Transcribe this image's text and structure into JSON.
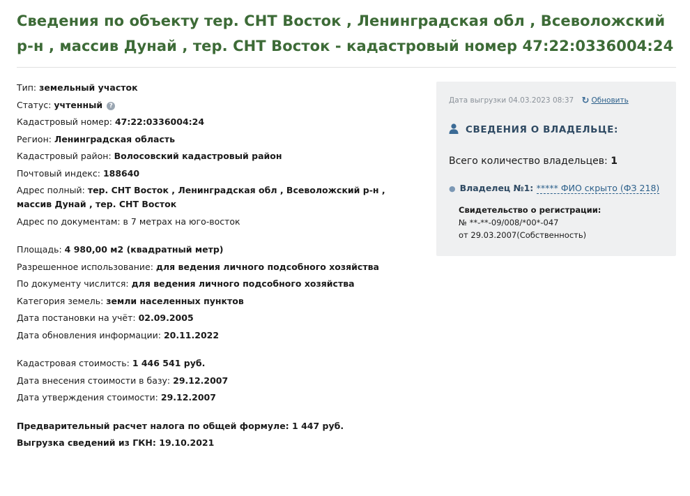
{
  "title": "Сведения по объекту тер. СНТ Восток , Ленинградская обл , Всеволожский р-н , массив Дунай , тер. СНТ Восток - кадастровый номер 47:22:0336004:24",
  "group1": [
    {
      "label": "Тип: ",
      "value": "земельный участок"
    },
    {
      "label": "Статус: ",
      "value": "учтенный"
    },
    {
      "label": "Кадастровый номер: ",
      "value": "47:22:0336004:24"
    },
    {
      "label": "Регион: ",
      "value": "Ленинградская область"
    },
    {
      "label": "Кадастровый район: ",
      "value": "Волосовский кадастровый район"
    },
    {
      "label": "Почтовый индекс: ",
      "value": "188640"
    },
    {
      "label": "Адрес полный: ",
      "value": "тер. СНТ Восток , Ленинградская обл , Всеволожский р-н , массив Дунай , тер. СНТ Восток"
    },
    {
      "label": "Адрес по документам: ",
      "value": "в 7 метрах на юго-восток"
    }
  ],
  "group2": [
    {
      "label": "Площадь: ",
      "value": "4 980,00 м2 (квадратный метр)"
    },
    {
      "label": "Разрешенное использование: ",
      "value": "для ведения личного подсобного хозяйства"
    },
    {
      "label": "По документу числится: ",
      "value": "для ведения личного подсобного хозяйства"
    },
    {
      "label": "Категория земель: ",
      "value": "земли населенных пунктов"
    },
    {
      "label": "Дата постановки на учёт: ",
      "value": "02.09.2005"
    },
    {
      "label": "Дата обновления информации: ",
      "value": "20.11.2022"
    }
  ],
  "group3": [
    {
      "label": "Кадастровая стоимость: ",
      "value": "1 446 541 руб."
    },
    {
      "label": "Дата внесения стоимости в базу: ",
      "value": "29.12.2007"
    },
    {
      "label": "Дата утверждения стоимости: ",
      "value": "29.12.2007"
    }
  ],
  "group4": [
    {
      "label": "Предварительный расчет налога по общей формуле: ",
      "value": "1 447 руб."
    },
    {
      "label": "Выгрузка сведений из ГКН: ",
      "value": "19.10.2021"
    }
  ],
  "status_help_icon": "?",
  "panel": {
    "export_label": "Дата выгрузки 04.03.2023 08:37",
    "refresh_icon": "↻",
    "refresh_label": "Обновить",
    "owner_heading": "СВЕДЕНИЯ О ВЛАДЕЛЬЦЕ:",
    "owner_count_label": "Всего количество владельцев: ",
    "owner_count": "1",
    "owner_label": "Владелец №1: ",
    "owner_link": "***** ФИО скрыто (ФЗ 218)",
    "cert_heading": "Свидетельство о регистрации:",
    "cert_number": "№ **-**-09/008/*00*-047",
    "cert_date": "от 29.03.2007(Собственность)"
  },
  "colors": {
    "title": "#3d6b37",
    "panel_bg": "#eff0f1",
    "link": "#2b5f8a",
    "heading": "#2f4a63"
  },
  "icons": [
    "help-icon",
    "refresh-icon",
    "person-icon"
  ]
}
